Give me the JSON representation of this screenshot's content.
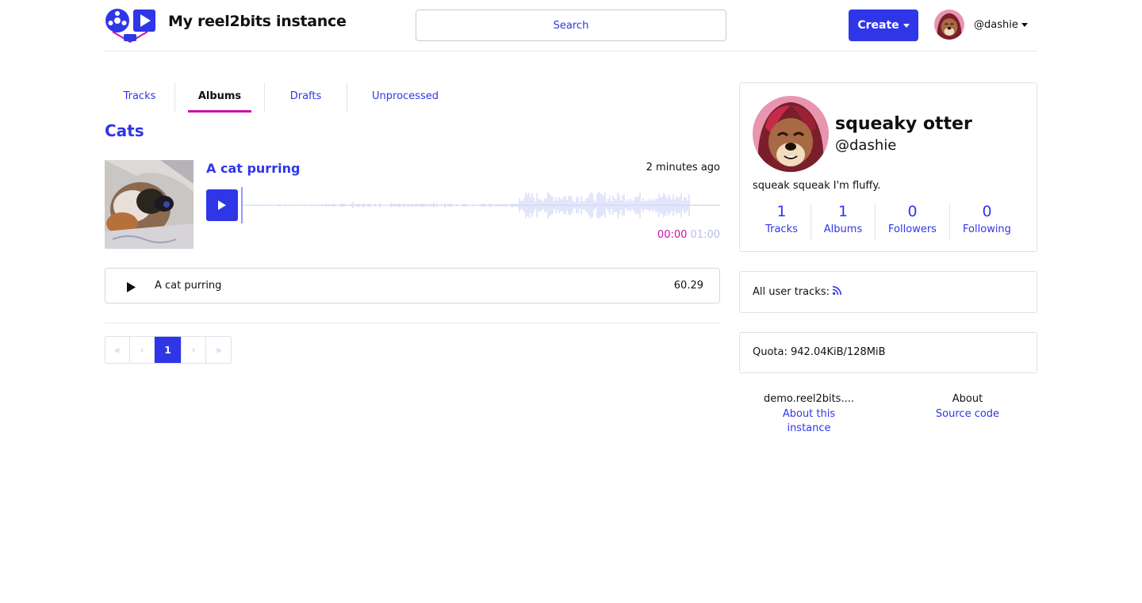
{
  "header": {
    "brand": "My reel2bits instance",
    "search_placeholder": "Search",
    "create_label": "Create",
    "username": "@dashie"
  },
  "tabs": [
    {
      "label": "Tracks"
    },
    {
      "label": "Albums"
    },
    {
      "label": "Drafts"
    },
    {
      "label": "Unprocessed"
    }
  ],
  "album": {
    "title": "Cats",
    "track": {
      "title": "A cat purring",
      "time_ago": "2 minutes ago",
      "current": "00:00",
      "duration": "01:00"
    },
    "tracklist": [
      {
        "name": "A cat purring",
        "duration": "60.29"
      }
    ]
  },
  "pagination": {
    "first": "«",
    "prev": "‹",
    "current": "1",
    "next": "›",
    "last": "»"
  },
  "profile": {
    "display_name": "squeaky otter",
    "handle": "@dashie",
    "bio": "squeak squeak I'm fluffy.",
    "stats": [
      {
        "value": "1",
        "label": "Tracks"
      },
      {
        "value": "1",
        "label": "Albums"
      },
      {
        "value": "0",
        "label": "Followers"
      },
      {
        "value": "0",
        "label": "Following"
      }
    ]
  },
  "rss": {
    "label": "All user tracks:",
    "icon": "rss-icon"
  },
  "quota": {
    "text": "Quota: 942.04KiB/128MiB"
  },
  "footer": {
    "instance_domain": "demo.reel2bits....",
    "about_instance": "About this instance",
    "about_head": "About",
    "source_code": "Source code"
  },
  "colors": {
    "accent": "#2f36e8",
    "highlight": "#cc10a6",
    "wave": "#c7cdf5"
  }
}
